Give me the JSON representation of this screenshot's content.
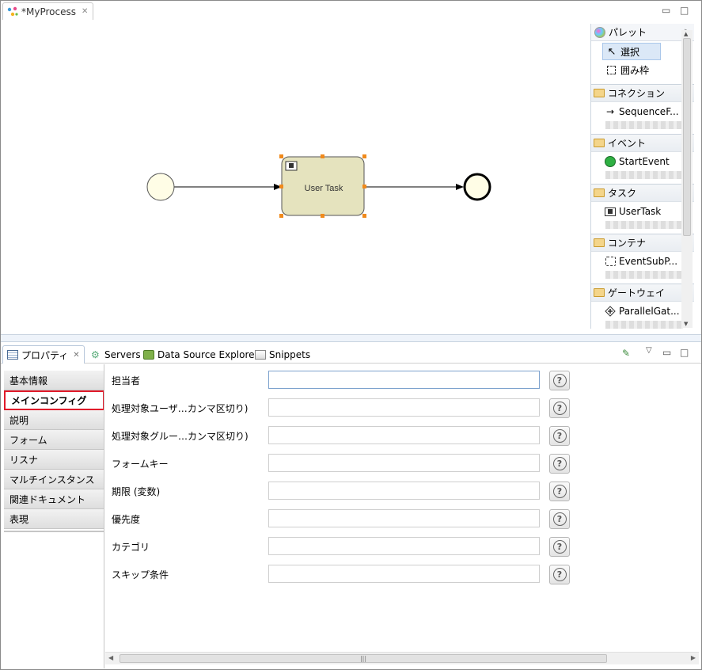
{
  "editor": {
    "tab_title": "*MyProcess",
    "task_label": "User Task"
  },
  "palette": {
    "title": "パレット",
    "tools": [
      {
        "label": "選択",
        "icon": "pointer-icon"
      },
      {
        "label": "囲み枠",
        "icon": "marquee-icon"
      }
    ],
    "drawers": [
      {
        "title": "コネクション",
        "item": "SequenceF..."
      },
      {
        "title": "イベント",
        "item": "StartEvent"
      },
      {
        "title": "タスク",
        "item": "UserTask"
      },
      {
        "title": "コンテナ",
        "item": "EventSubP..."
      },
      {
        "title": "ゲートウェイ",
        "item": "ParallelGat..."
      }
    ]
  },
  "views": {
    "tabs": [
      {
        "label": "プロパティ",
        "active": true
      },
      {
        "label": "Servers"
      },
      {
        "label": "Data Source Explorer"
      },
      {
        "label": "Snippets"
      }
    ]
  },
  "properties": {
    "sections": [
      "基本情報",
      "メインコンフィグ",
      "説明",
      "フォーム",
      "リスナ",
      "マルチインスタンス",
      "関連ドキュメント",
      "表現"
    ],
    "selected_section": "メインコンフィグ",
    "fields": [
      {
        "label": "担当者",
        "value": ""
      },
      {
        "label": "処理対象ユーザ…カンマ区切り)",
        "value": ""
      },
      {
        "label": "処理対象グルー…カンマ区切り)",
        "value": ""
      },
      {
        "label": "フォームキー",
        "value": ""
      },
      {
        "label": "期限 (変数)",
        "value": ""
      },
      {
        "label": "優先度",
        "value": ""
      },
      {
        "label": "カテゴリ",
        "value": ""
      },
      {
        "label": "スキップ条件",
        "value": ""
      }
    ],
    "help_glyph": "?"
  }
}
